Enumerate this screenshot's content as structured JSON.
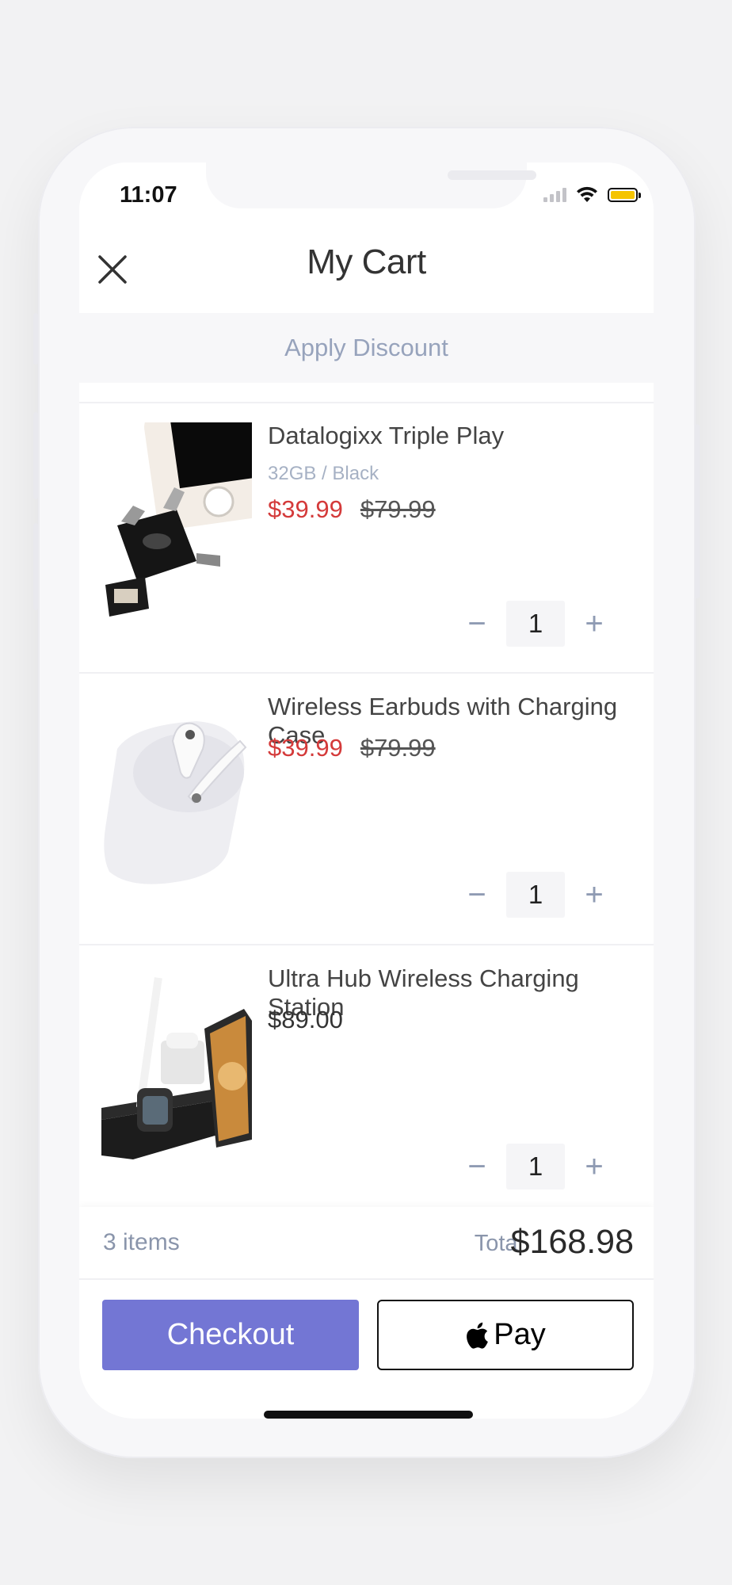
{
  "status_bar": {
    "time": "11:07"
  },
  "header": {
    "title": "My Cart"
  },
  "discount": {
    "label": "Apply Discount"
  },
  "cart_items": [
    {
      "name": "Datalogixx Triple Play",
      "variant": "32GB / Black",
      "sale_price": "$39.99",
      "original_price": "$79.99",
      "quantity": "1"
    },
    {
      "name": "Wireless Earbuds with Charging Case",
      "sale_price": "$39.99",
      "original_price": "$79.99",
      "quantity": "1"
    },
    {
      "name": "Ultra Hub Wireless Charging Station",
      "price": "$89.00",
      "quantity": "1"
    }
  ],
  "quantity_controls": {
    "minus": "−",
    "plus": "+"
  },
  "footer": {
    "items_count": "3 items",
    "total_label": "Total",
    "total_value": "$168.98"
  },
  "buttons": {
    "checkout": "Checkout",
    "apple_pay": "Pay"
  },
  "colors": {
    "accent": "#7376d4",
    "sale": "#d43a3a",
    "muted": "#97a3bc",
    "battery": "#f5c400"
  }
}
